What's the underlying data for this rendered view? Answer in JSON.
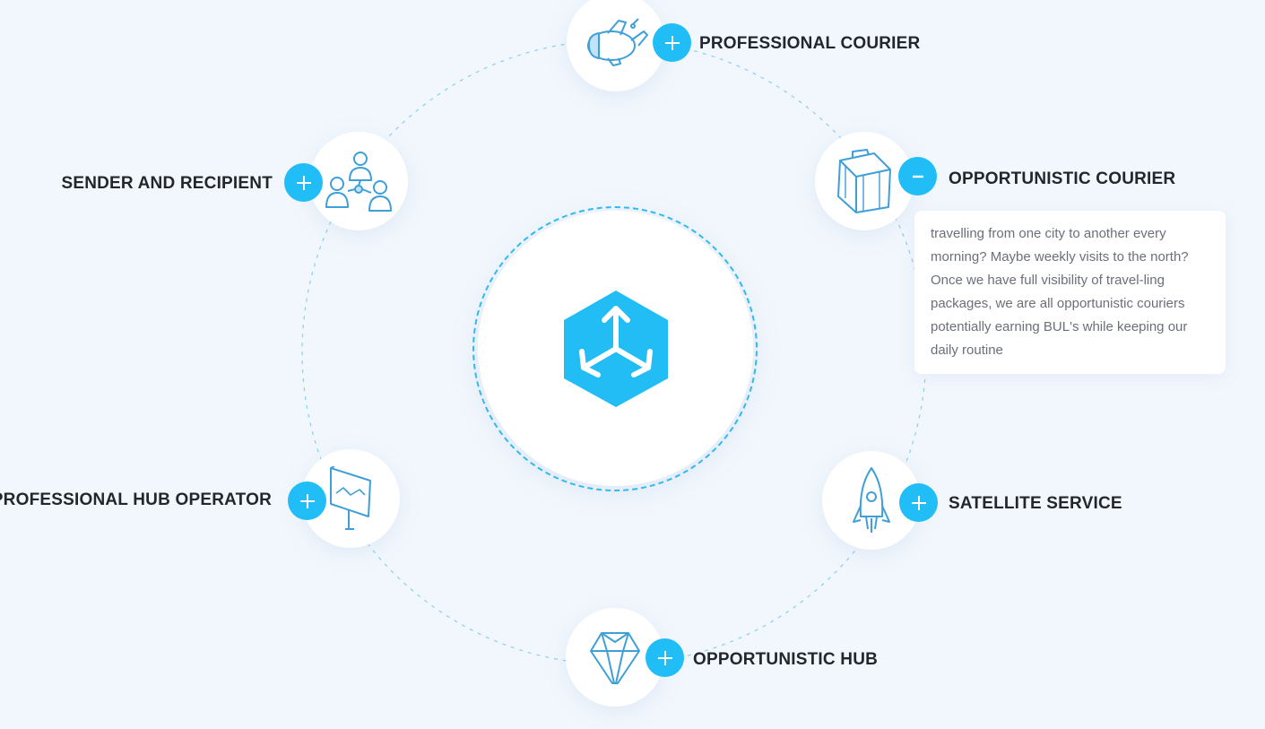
{
  "colors": {
    "accent": "#20bdf6",
    "icon_stroke": "#3f9fd8",
    "background": "#f2f7fd",
    "label": "#23262e",
    "body_text": "#6b6f78"
  },
  "center": {
    "icon": "cube-arrows-icon"
  },
  "nodes": [
    {
      "id": "professional-courier",
      "label": "PROFESSIONAL COURIER",
      "icon": "airplane-icon",
      "state": "collapsed"
    },
    {
      "id": "opportunistic-courier",
      "label": "OPPORTUNISTIC COURIER",
      "icon": "suitcase-icon",
      "state": "expanded",
      "description": "travelling from one city to another every morning? Maybe weekly visits to the north? Once we have full visibility of travel-ling packages, we are all opportunistic couriers potentially earning BUL's while keeping our daily routine"
    },
    {
      "id": "satellite-service",
      "label": "SATELLITE SERVICE",
      "icon": "rocket-icon",
      "state": "collapsed"
    },
    {
      "id": "opportunistic-hub",
      "label": "OPPORTUNISTIC HUB",
      "icon": "diamond-icon",
      "state": "collapsed"
    },
    {
      "id": "professional-hub-operator",
      "label": "PROFESSIONAL HUB OPERATOR",
      "icon": "presentation-board-icon",
      "state": "collapsed"
    },
    {
      "id": "sender-and-recipient",
      "label": "SENDER AND RECIPIENT",
      "icon": "people-network-icon",
      "state": "collapsed"
    }
  ]
}
